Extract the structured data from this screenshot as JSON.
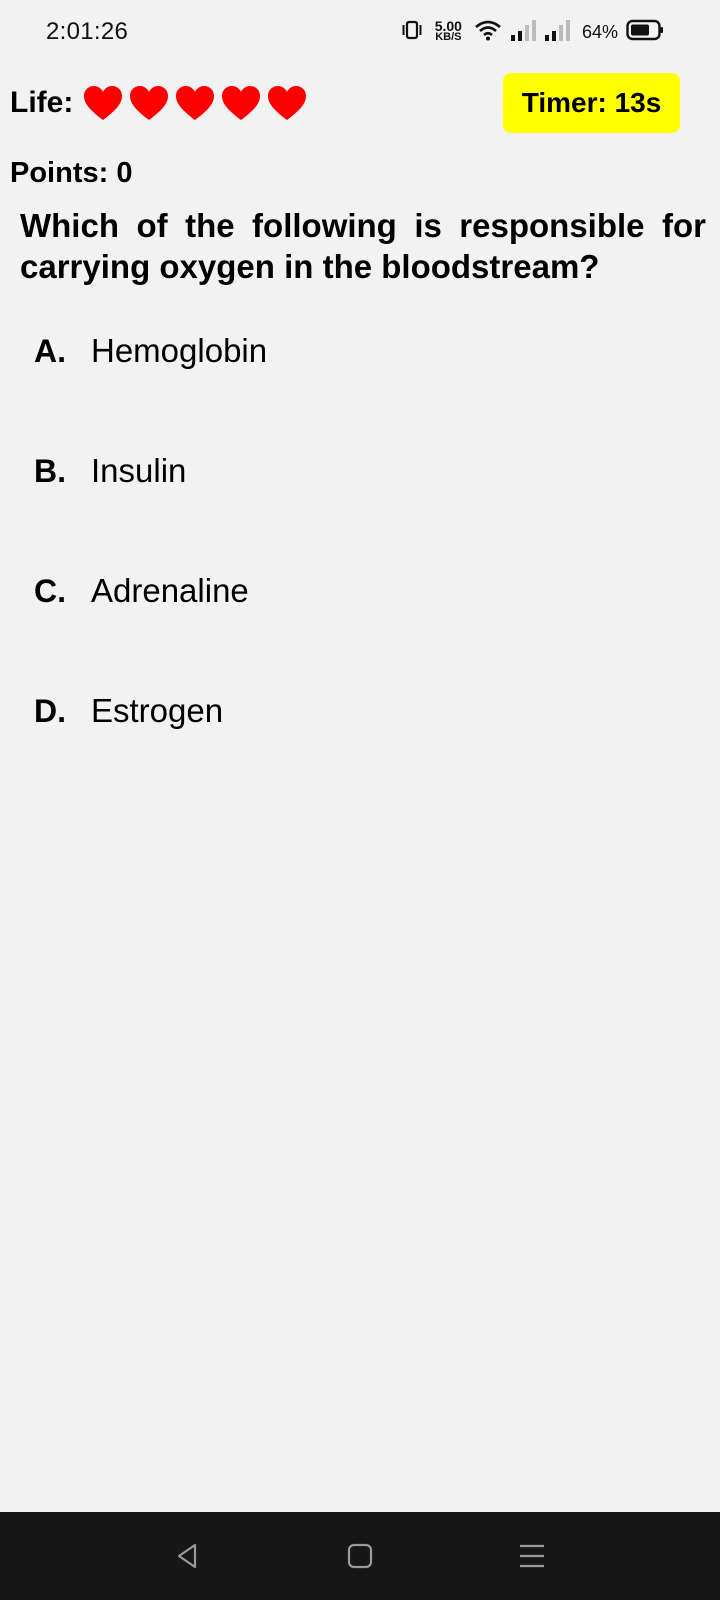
{
  "status_bar": {
    "time": "2:01:26",
    "net_speed_value": "5.00",
    "net_speed_unit": "KB/S",
    "battery_percent": "64%",
    "icons": [
      "vibrate-icon",
      "wifi-icon",
      "signal-1-icon",
      "signal-2-icon",
      "battery-icon"
    ]
  },
  "game": {
    "life_label": "Life:",
    "lives": 5,
    "heart_color": "#ff0000",
    "timer_label": "Timer: 13s",
    "timer_color": "#ffff00",
    "points_label": "Points: 0"
  },
  "question": {
    "text": "Which of the following is responsible for carrying oxygen in the bloodstream?",
    "options": [
      {
        "letter": "A.",
        "text": "Hemoglobin"
      },
      {
        "letter": "B.",
        "text": "Insulin"
      },
      {
        "letter": "C.",
        "text": "Adrenaline"
      },
      {
        "letter": "D.",
        "text": "Estrogen"
      }
    ]
  },
  "nav_bar": {
    "icons": [
      "back-icon",
      "home-icon",
      "recents-icon"
    ]
  }
}
